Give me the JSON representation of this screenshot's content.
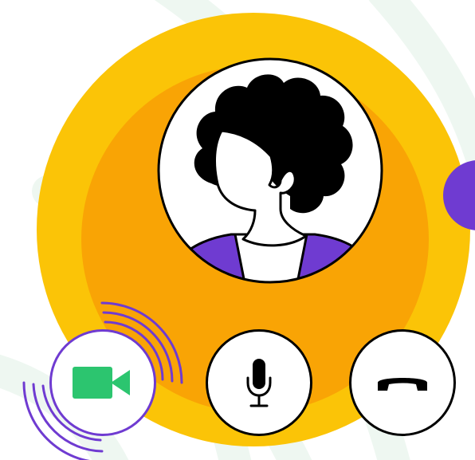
{
  "call": {
    "avatar_icon": "woman-avatar-icon",
    "controls": [
      {
        "id": "video",
        "icon": "video-camera-icon",
        "active": true
      },
      {
        "id": "mic",
        "icon": "microphone-icon",
        "active": false
      },
      {
        "id": "hangup",
        "icon": "phone-hangup-icon",
        "active": false
      }
    ]
  },
  "colors": {
    "outer_circle": "#fbc407",
    "inner_circle": "#f9a405",
    "accent_purple": "#6f3bd1",
    "video_green": "#2cc56f",
    "outline": "#000000",
    "background": "#ffffff",
    "swirl": "#eef7f1"
  }
}
